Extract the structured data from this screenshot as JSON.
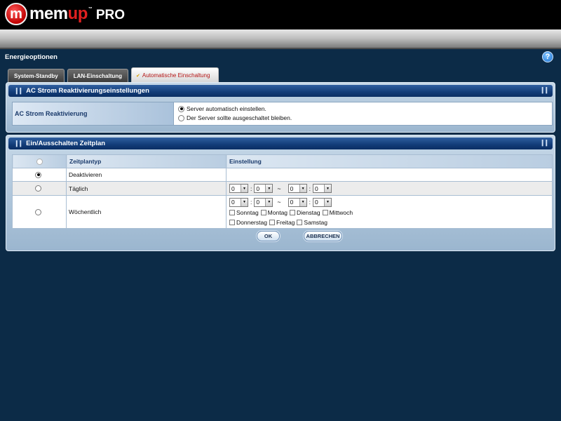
{
  "brand": {
    "badge": "m",
    "name_left": "mem",
    "name_right": "up",
    "tm": "™",
    "suffix": "PRO"
  },
  "page": {
    "title": "Energieoptionen",
    "help_label": "?"
  },
  "tabs": [
    {
      "label": "System-Standby",
      "active": false
    },
    {
      "label": "LAN-Einschaltung",
      "active": false
    },
    {
      "label": "Automatische Einschaltung",
      "active": true
    }
  ],
  "ac_section": {
    "title": "AC Strom Reaktivierungseinstellungen",
    "row_label": "AC Strom Reaktivierung",
    "options": [
      {
        "label": "Server automatisch einstellen.",
        "selected": true
      },
      {
        "label": "Der Server sollte ausgeschaltet bleiben.",
        "selected": false
      }
    ]
  },
  "schedule_section": {
    "title": "Ein/Ausschalten Zeitplan",
    "col_type": "Zeitplantyp",
    "col_setting": "Einstellung",
    "rows": [
      {
        "label": "Deaktivieren",
        "selected": true
      },
      {
        "label": "Täglich",
        "selected": false
      },
      {
        "label": "Wöchentlich",
        "selected": false
      }
    ],
    "time_separator": ":",
    "range_separator": "~",
    "daily_time": {
      "start_hour": "0",
      "start_min": "0",
      "end_hour": "0",
      "end_min": "0"
    },
    "weekly_time": {
      "start_hour": "0",
      "start_min": "0",
      "end_hour": "0",
      "end_min": "0"
    },
    "days_row1": [
      "Sonntag",
      "Montag",
      "Dienstag",
      "Mittwoch"
    ],
    "days_row2": [
      "Donnerstag",
      "Freitag",
      "Samstag"
    ]
  },
  "buttons": {
    "ok": "OK",
    "cancel": "ABBRECHEN"
  },
  "colors": {
    "background": "#0c2b47",
    "panel_header": "#123c78",
    "active_tab_text": "#b41414"
  }
}
